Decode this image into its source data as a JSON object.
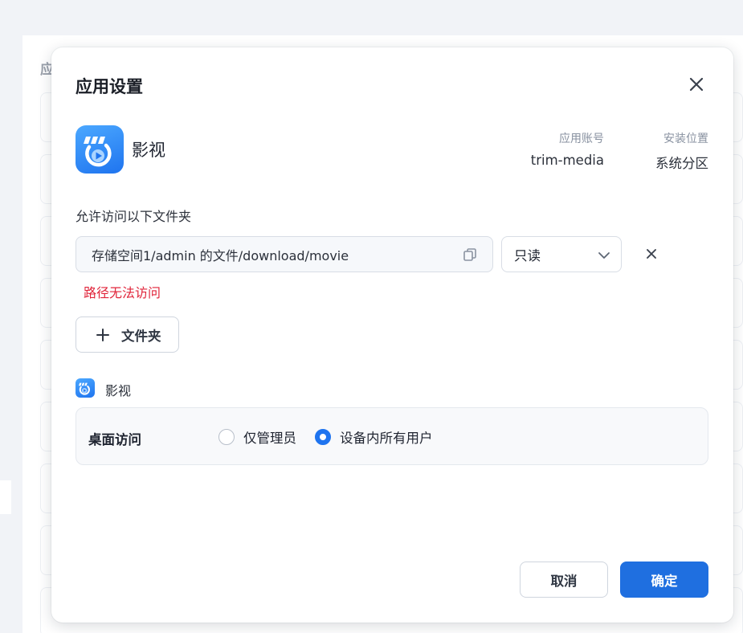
{
  "background": {
    "page_title_fragment": "应"
  },
  "dialog": {
    "title": "应用设置",
    "app": {
      "name": "影视",
      "icon": "video-app-icon",
      "account_label": "应用账号",
      "account_value": "trim-media",
      "location_label": "安装位置",
      "location_value": "系统分区"
    },
    "folders": {
      "label": "允许访问以下文件夹",
      "items": [
        {
          "path": "存储空间1/admin 的文件/download/movie",
          "permission": "只读",
          "error": "路径无法访问"
        }
      ],
      "add_button_label": "文件夹"
    },
    "desktop_access": {
      "app_name": "影视",
      "label": "桌面访问",
      "options": [
        {
          "label": "仅管理员",
          "selected": false
        },
        {
          "label": "设备内所有用户",
          "selected": true
        }
      ]
    },
    "buttons": {
      "cancel": "取消",
      "confirm": "确定"
    }
  },
  "colors": {
    "accent": "#1f6fe0",
    "error": "#e0243a",
    "icon_gradient_start": "#4ba8ff",
    "icon_gradient_end": "#1f74ef"
  }
}
